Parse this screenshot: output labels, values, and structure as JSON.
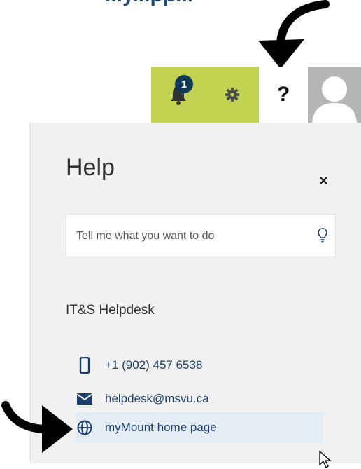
{
  "header": {
    "cut_off_text": "...y...pp...",
    "notification_count": "1",
    "help_symbol": "?"
  },
  "panel": {
    "title": "Help",
    "close_symbol": "×",
    "search_placeholder": "Tell me what you want to do",
    "section_title": "IT&S Helpdesk",
    "contacts": {
      "phone": "+1 (902) 457 6538",
      "email": "helpdesk@msvu.ca",
      "home": "myMount home page"
    }
  },
  "icons": [
    "bell-icon",
    "gear-icon",
    "help-icon",
    "avatar-icon",
    "close-icon",
    "lightbulb-icon",
    "phone-icon",
    "mail-icon",
    "globe-icon",
    "cursor-icon",
    "arrow-icon"
  ],
  "colors": {
    "tile_accent": "#c2d251",
    "badge": "#0f3a57",
    "link": "#1b3d6e",
    "panel_bg": "#f1f1f1",
    "hover_bg": "#e4ecf4"
  }
}
